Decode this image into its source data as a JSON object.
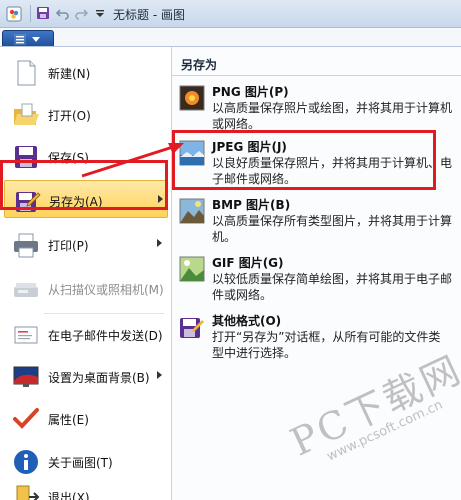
{
  "window": {
    "title": "无标题 - 画图"
  },
  "left_menu": {
    "items": [
      {
        "label": "新建(N)",
        "icon": "new-file-icon",
        "has_submenu": false,
        "disabled": false
      },
      {
        "label": "打开(O)",
        "icon": "open-folder-icon",
        "has_submenu": false,
        "disabled": false
      },
      {
        "label": "保存(S)",
        "icon": "save-disk-icon",
        "has_submenu": false,
        "disabled": false
      },
      {
        "label": "另存为(A)",
        "icon": "save-as-icon",
        "has_submenu": true,
        "disabled": false,
        "active": true
      },
      {
        "label": "打印(P)",
        "icon": "printer-icon",
        "has_submenu": true,
        "disabled": false
      },
      {
        "label": "从扫描仪或照相机(M)",
        "icon": "scanner-icon",
        "has_submenu": false,
        "disabled": true
      },
      {
        "label": "在电子邮件中发送(D)",
        "icon": "email-icon",
        "has_submenu": false,
        "disabled": false
      },
      {
        "label": "设置为桌面背景(B)",
        "icon": "desktop-background-icon",
        "has_submenu": true,
        "disabled": false
      },
      {
        "label": "属性(E)",
        "icon": "checkmark-icon",
        "has_submenu": false,
        "disabled": false
      },
      {
        "label": "关于画图(T)",
        "icon": "info-icon",
        "has_submenu": false,
        "disabled": false
      },
      {
        "label": "退出(X)",
        "icon": "exit-icon",
        "has_submenu": false,
        "disabled": false
      }
    ]
  },
  "save_as_pane": {
    "title": "另存为",
    "options": [
      {
        "title": "PNG 图片(P)",
        "desc": "以高质量保存照片或绘图，并将其用于计算机或网络。",
        "icon": "png-image-icon"
      },
      {
        "title": "JPEG 图片(J)",
        "desc": "以良好质量保存照片，并将其用于计算机、电子邮件或网络。",
        "icon": "jpeg-image-icon",
        "highlighted": true
      },
      {
        "title": "BMP 图片(B)",
        "desc": "以高质量保存所有类型图片，并将其用于计算机。",
        "icon": "bmp-image-icon"
      },
      {
        "title": "GIF 图片(G)",
        "desc": "以较低质量保存简单绘图，并将其用于电子邮件或网络。",
        "icon": "gif-image-icon"
      },
      {
        "title": "其他格式(O)",
        "desc": "打开“另存为”对话框，从所有可能的文件类型中进行选择。",
        "icon": "other-formats-icon"
      }
    ]
  },
  "watermark": {
    "main": "PC下载网",
    "url": "www.pcsoft.com.cn"
  },
  "colors": {
    "highlight_red": "#e21b22",
    "active_item": "#ffd25a",
    "ribbon_blue": "#2a5ca8"
  }
}
